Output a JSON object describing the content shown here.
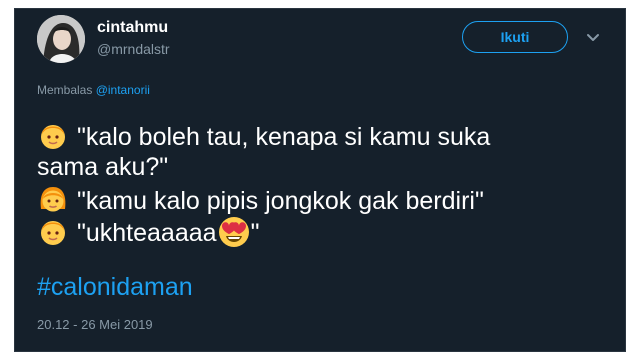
{
  "user": {
    "display_name": "cintahmu",
    "handle": "@mrndalstr"
  },
  "follow_button_label": "Ikuti",
  "reply": {
    "prefix": "Membalas",
    "mention": "@intanorii"
  },
  "tweet": {
    "lines": [
      {
        "emoji": "boy-face",
        "text": "\"kalo boleh tau, kenapa si kamu suka"
      },
      {
        "emoji": "",
        "text": "sama aku?\""
      },
      {
        "emoji": "girl-face",
        "text": "\"kamu kalo pipis jongkok gak berdiri\""
      },
      {
        "emoji": "boy-face",
        "text": "\"ukhteaaaaa",
        "trailing_emoji": "heart-eyes-face",
        "closing": "\""
      }
    ],
    "hashtag": "#calonidaman",
    "timestamp": "20.12 - 26 Mei 2019"
  },
  "colors": {
    "background": "#15202b",
    "accent": "#1da1f2",
    "secondary_text": "#8899a6"
  },
  "icons": {
    "avatar": "profile-photo",
    "menu": "chevron-down-icon"
  }
}
